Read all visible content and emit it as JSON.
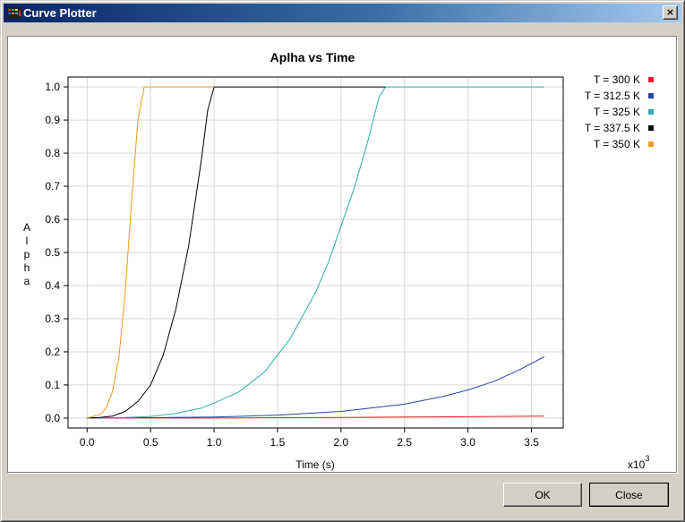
{
  "window": {
    "title": "Curve Plotter",
    "close_glyph": "×"
  },
  "buttons": {
    "ok_label": "OK",
    "close_label": "Close"
  },
  "colors": {
    "T300": "#e0202a",
    "T312_5": "#2b43a8",
    "T325": "#2bb0a8",
    "T337_5": "#000000",
    "T350": "#f49a1a"
  },
  "chart_data": {
    "type": "line",
    "title": "Aplha vs Time",
    "xlabel": "Time (s)",
    "ylabel": "Alpha",
    "x_multiplier_label": "x10",
    "x_multiplier_exponent": "3",
    "xlim": [
      -0.15,
      3.75
    ],
    "ylim": [
      -0.03,
      1.03
    ],
    "xticks": [
      0.0,
      0.5,
      1.0,
      1.5,
      2.0,
      2.5,
      3.0,
      3.5
    ],
    "xtick_labels": [
      "0.0",
      "0.5",
      "1.0",
      "1.5",
      "2.0",
      "2.5",
      "3.0",
      "3.5"
    ],
    "yticks": [
      0.0,
      0.1,
      0.2,
      0.3,
      0.4,
      0.5,
      0.6,
      0.7,
      0.8,
      0.9,
      1.0
    ],
    "ytick_labels": [
      "0.0",
      "0.1",
      "0.2",
      "0.3",
      "0.4",
      "0.5",
      "0.6",
      "0.7",
      "0.8",
      "0.9",
      "1.0"
    ],
    "grid": true,
    "legend_position": "right",
    "series": [
      {
        "name": "T = 300 K",
        "color": "#e0202a",
        "x": [
          0.0,
          0.5,
          1.0,
          1.5,
          2.0,
          2.5,
          3.0,
          3.6
        ],
        "y": [
          0.0,
          0.0,
          0.0,
          0.001,
          0.002,
          0.003,
          0.004,
          0.006
        ]
      },
      {
        "name": "T = 312.5 K",
        "color": "#2b43a8",
        "x": [
          0.0,
          0.5,
          1.0,
          1.5,
          2.0,
          2.5,
          2.8,
          3.0,
          3.2,
          3.4,
          3.6
        ],
        "y": [
          0.0,
          0.001,
          0.003,
          0.009,
          0.02,
          0.042,
          0.065,
          0.085,
          0.11,
          0.145,
          0.185
        ]
      },
      {
        "name": "T = 325 K",
        "color": "#2bb0a8",
        "x": [
          0.0,
          0.3,
          0.5,
          0.7,
          0.9,
          1.0,
          1.2,
          1.4,
          1.6,
          1.8,
          1.9,
          2.0,
          2.1,
          2.2,
          2.3,
          2.35,
          2.6,
          3.0,
          3.6
        ],
        "y": [
          0.0,
          0.002,
          0.005,
          0.014,
          0.03,
          0.045,
          0.08,
          0.14,
          0.24,
          0.38,
          0.47,
          0.58,
          0.69,
          0.82,
          0.97,
          1.0,
          1.0,
          1.0,
          1.0
        ]
      },
      {
        "name": "T = 337.5 K",
        "color": "#000000",
        "x": [
          0.0,
          0.1,
          0.2,
          0.3,
          0.4,
          0.5,
          0.6,
          0.7,
          0.8,
          0.9,
          0.95,
          1.0,
          1.5,
          2.0,
          2.35
        ],
        "y": [
          0.0,
          0.002,
          0.006,
          0.02,
          0.05,
          0.1,
          0.19,
          0.33,
          0.52,
          0.78,
          0.93,
          1.0,
          1.0,
          1.0,
          1.0
        ]
      },
      {
        "name": "T = 350 K",
        "color": "#f49a1a",
        "x": [
          0.0,
          0.1,
          0.15,
          0.2,
          0.25,
          0.3,
          0.35,
          0.4,
          0.45,
          0.5,
          0.7,
          1.0
        ],
        "y": [
          0.0,
          0.01,
          0.03,
          0.08,
          0.18,
          0.38,
          0.65,
          0.9,
          1.0,
          1.0,
          1.0,
          1.0
        ]
      }
    ]
  }
}
